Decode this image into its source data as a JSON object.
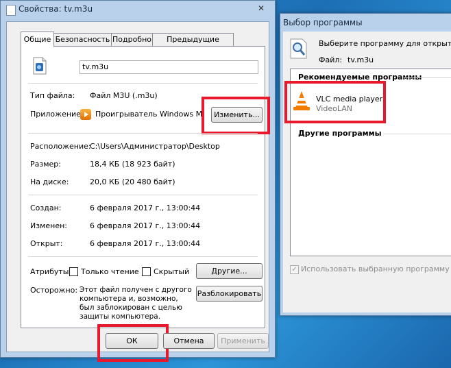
{
  "props": {
    "title": "Свойства: tv.m3u",
    "close": "✕",
    "tabs": [
      "Общие",
      "Безопасность",
      "Подробно",
      "Предыдущие версии"
    ],
    "filename": "tv.m3u",
    "type_label": "Тип файла:",
    "type_value": "Файл M3U (.m3u)",
    "app_label": "Приложение:",
    "app_value": "Проигрыватель Windows Medi",
    "change_button": "Изменить...",
    "location_label": "Расположение:",
    "location_value": "C:\\Users\\Администратор\\Desktop",
    "size_label": "Размер:",
    "size_value": "18,4 КБ (18 923 байт)",
    "disk_label": "На диске:",
    "disk_value": "20,0 КБ (20 480 байт)",
    "created_label": "Создан:",
    "created_value": "6 февраля 2017 г., 13:00:44",
    "modified_label": "Изменен:",
    "modified_value": "6 февраля 2017 г., 13:00:44",
    "opened_label": "Открыт:",
    "opened_value": "6 февраля 2017 г., 13:00:44",
    "attributes_label": "Атрибуты:",
    "readonly_label": "Только чтение",
    "hidden_label": "Скрытый",
    "other_button": "Другие...",
    "warning_label": "Осторожно:",
    "warning_text": "Этот файл получен с другого компьютера и, возможно, был заблокирован с целью защиты компьютера.",
    "unblock_button": "Разблокировать",
    "ok_button": "ОК",
    "cancel_button": "Отмена",
    "apply_button": "Применить"
  },
  "openwith": {
    "title": "Выбор программы",
    "prompt": "Выберите программу для открытия эт",
    "file_label": "Файл:",
    "file_value": "tv.m3u",
    "recommended_header": "Рекомендуемые программы",
    "program_name": "VLC media player",
    "program_vendor": "VideoLAN",
    "other_header": "Другие программы",
    "always_use": "Использовать выбранную программу для в"
  },
  "colors": {
    "highlight": "#e8182d",
    "titlebar": "#b9d1ea"
  }
}
